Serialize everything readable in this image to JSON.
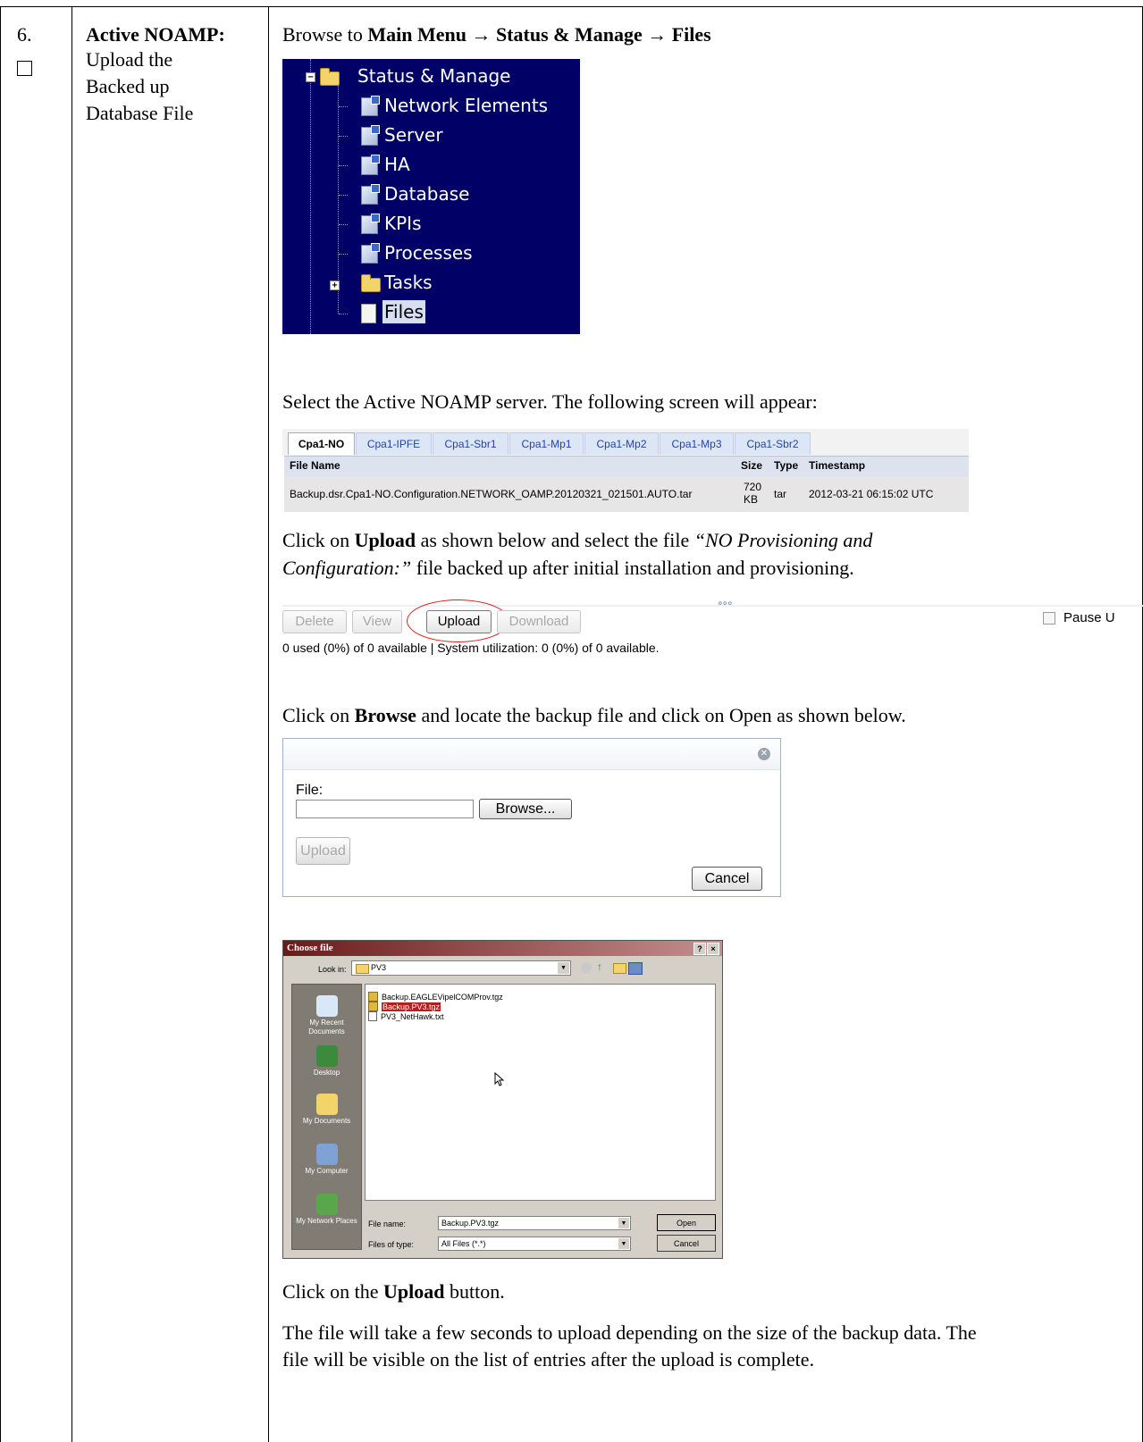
{
  "step": {
    "number": "6.",
    "checkbox_glyph": "☐",
    "title": "Active NOAMP:",
    "description_lines": [
      "Upload the",
      "Backed up",
      "Database File"
    ]
  },
  "instructions": {
    "browse_prefix": "Browse to ",
    "browse_path": "Main Menu → Status & Manage → Files",
    "select_server": "Select the Active NOAMP server. The following screen will appear:",
    "upload_line1_prefix": "Click on ",
    "upload_line1_bold": "Upload",
    "upload_line1_mid": " as shown below and select the file ",
    "upload_line1_italic": "“NO Provisioning and",
    "upload_line2_italic": "Configuration:”",
    "upload_line2_rest": " file backed up after initial installation and provisioning.",
    "browse_line_prefix": "Click on ",
    "browse_line_bold": "Browse",
    "browse_line_rest": " and locate the backup file and click on Open as shown below.",
    "click_upload_prefix": "Click on the ",
    "click_upload_bold": "Upload",
    "click_upload_rest": " button.",
    "final_line1": "The file will take a few seconds to upload depending on the size of the backup data. The",
    "final_line2": "file will be visible on the list of entries after the upload is complete."
  },
  "menu_tree": {
    "root": "Status & Manage",
    "items": [
      "Network Elements",
      "Server",
      "HA",
      "Database",
      "KPIs",
      "Processes",
      "Tasks",
      "Files"
    ],
    "colors": {
      "background": "#000066",
      "selected": "#d6def2"
    }
  },
  "file_table": {
    "tabs": [
      "Cpa1-NO",
      "Cpa1-IPFE",
      "Cpa1-Sbr1",
      "Cpa1-Mp1",
      "Cpa1-Mp2",
      "Cpa1-Mp3",
      "Cpa1-Sbr2"
    ],
    "active_tab": "Cpa1-NO",
    "columns": [
      "File Name",
      "Size",
      "Type",
      "Timestamp"
    ],
    "rows": [
      {
        "file_name": "Backup.dsr.Cpa1-NO.Configuration.NETWORK_OAMP.20120321_021501.AUTO.tar",
        "size_line1": "720",
        "size_line2": "KB",
        "type": "tar",
        "timestamp": "2012-03-21 06:15:02 UTC"
      }
    ]
  },
  "toolbar": {
    "buttons": [
      "Delete",
      "View",
      "Upload",
      "Download"
    ],
    "pause_label": "Pause U",
    "usage": "0 used (0%) of 0 available | System utilization: 0 (0%) of 0 available."
  },
  "upload_dialog": {
    "file_label": "File:",
    "browse_button": "Browse...",
    "upload_button": "Upload",
    "cancel_button": "Cancel"
  },
  "choose_file_dialog": {
    "title": "Choose file",
    "look_in_label": "Look in:",
    "look_in_value": "PV3",
    "files": [
      "Backup.EAGLEVipelCOMProv.tgz",
      "Backup.PV3.tgz",
      "PV3_NetHawk.txt"
    ],
    "selected_file": "Backup.PV3.tgz",
    "places": [
      "My Recent Documents",
      "Desktop",
      "My Documents",
      "My Computer",
      "My Network Places"
    ],
    "file_name_label": "File name:",
    "file_name_value": "Backup.PV3.tgz",
    "files_of_type_label": "Files of type:",
    "files_of_type_value": "All Files (*.*)",
    "open_button": "Open",
    "cancel_button": "Cancel",
    "title_bar_color": "#6b1a1a"
  }
}
